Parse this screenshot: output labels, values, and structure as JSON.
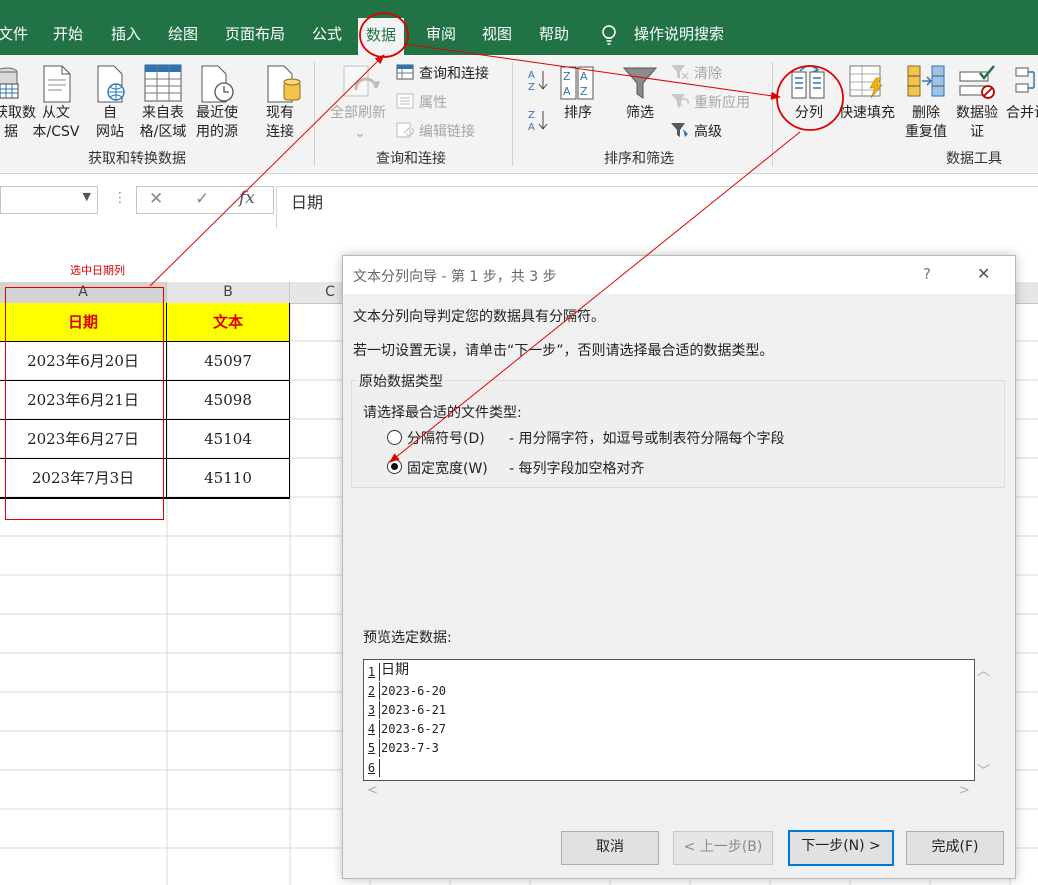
{
  "ribbon_tabs": [
    "文件",
    "开始",
    "插入",
    "绘图",
    "页面布局",
    "公式",
    "数据",
    "审阅",
    "视图",
    "帮助"
  ],
  "active_tab": "数据",
  "search_label": "操作说明搜索",
  "groups": {
    "get_transform": {
      "label": "获取和转换数据",
      "get_data": [
        "获取数",
        "据"
      ],
      "from_text": [
        "从文",
        "本/CSV"
      ],
      "from_web": [
        "自",
        "网站"
      ],
      "from_table": [
        "来自表",
        "格/区域"
      ],
      "recent": [
        "最近使",
        "用的源"
      ],
      "existing": [
        "现有",
        "连接"
      ]
    },
    "queries": {
      "label": "查询和连接",
      "refresh_all": "全部刷新",
      "queries_connections": "查询和连接",
      "properties": "属性",
      "edit_links": "编辑链接"
    },
    "sort_filter": {
      "label": "排序和筛选",
      "sort": "排序",
      "filter": "筛选",
      "clear": "清除",
      "reapply": "重新应用",
      "advanced": "高级"
    },
    "data_tools": {
      "label": "数据工具",
      "text_to_columns": "分列",
      "flash_fill": "快速填充",
      "remove_duplicates": [
        "删除",
        "重复值"
      ],
      "data_validation": [
        "数据验",
        "证"
      ],
      "consolidate": "合并计"
    }
  },
  "formula_bar": {
    "value": "日期"
  },
  "annotation": "选中日期列",
  "columns": [
    "A",
    "B",
    "C"
  ],
  "table": {
    "headers": [
      "日期",
      "文本"
    ],
    "rows": [
      [
        "2023年6月20日",
        "45097"
      ],
      [
        "2023年6月21日",
        "45098"
      ],
      [
        "2023年6月27日",
        "45104"
      ],
      [
        "2023年7月3日",
        "45110"
      ]
    ]
  },
  "dialog": {
    "title": "文本分列向导 - 第 1 步，共 3 步",
    "help": "?",
    "close": "✕",
    "intro": "文本分列向导判定您的数据具有分隔符。",
    "hint": "若一切设置无误，请单击“下一步”，否则请选择最合适的数据类型。",
    "group_title": "原始数据类型",
    "choose_label": "请选择最合适的文件类型:",
    "options": [
      {
        "label": "分隔符号(D)",
        "desc": "- 用分隔字符，如逗号或制表符分隔每个字段",
        "selected": false
      },
      {
        "label": "固定宽度(W)",
        "desc": "- 每列字段加空格对齐",
        "selected": true
      }
    ],
    "preview_label": "预览选定数据:",
    "preview_rows": [
      {
        "num": "1",
        "text": "日期"
      },
      {
        "num": "2",
        "text": "2023-6-20"
      },
      {
        "num": "3",
        "text": "2023-6-21"
      },
      {
        "num": "4",
        "text": "2023-6-27"
      },
      {
        "num": "5",
        "text": "2023-7-3"
      },
      {
        "num": "6",
        "text": ""
      }
    ],
    "buttons": {
      "cancel": "取消",
      "back": "< 上一步(B)",
      "next": "下一步(N) >",
      "finish": "完成(F)"
    }
  },
  "colors": {
    "excel_green": "#217346",
    "annotation_red": "#e00000",
    "header_fill": "#ffff00"
  }
}
